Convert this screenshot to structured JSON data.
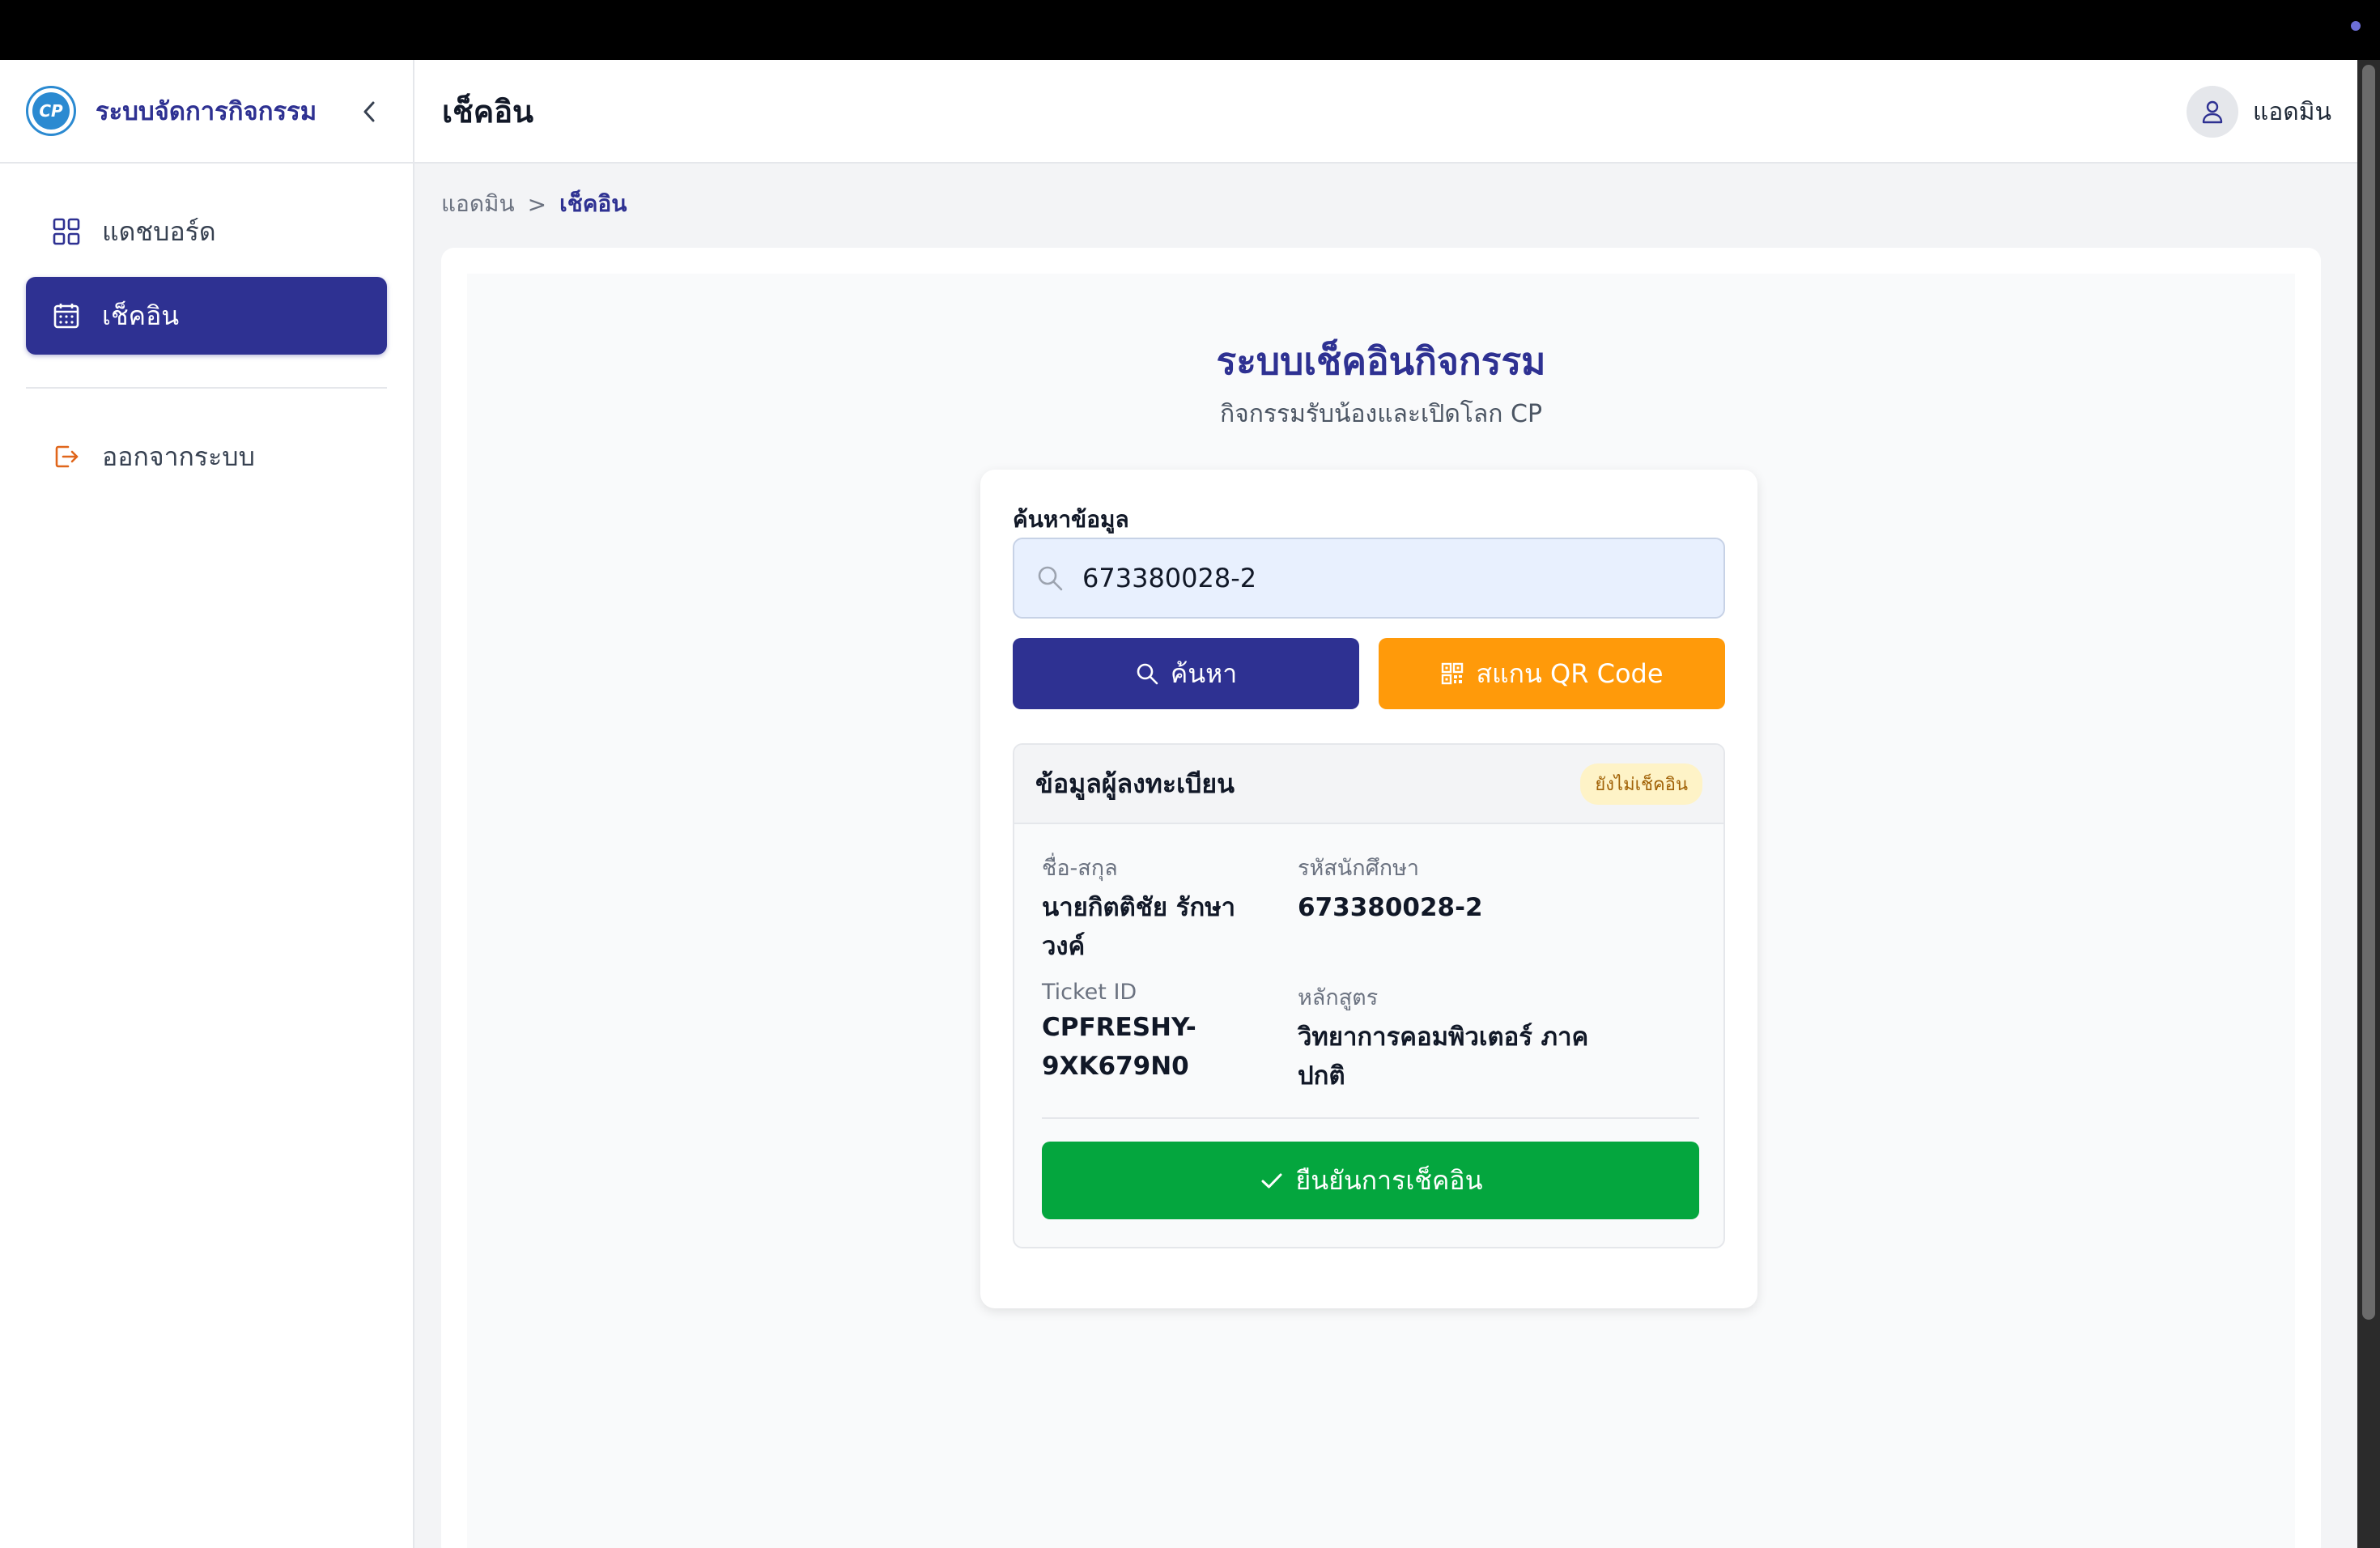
{
  "app": {
    "title": "ระบบจัดการกิจกรรม",
    "logo_text": "CP"
  },
  "sidebar": {
    "items": [
      {
        "label": "แดชบอร์ด",
        "icon": "grid-icon",
        "active": false
      },
      {
        "label": "เช็คอิน",
        "icon": "calendar-icon",
        "active": true
      }
    ],
    "logout_label": "ออกจากระบบ"
  },
  "header": {
    "title": "เช็คอิน",
    "user_name": "แอดมิน"
  },
  "breadcrumb": {
    "root": "แอดมิน",
    "separator": ">",
    "current": "เช็คอิน"
  },
  "main": {
    "title": "ระบบเช็คอินกิจกรรม",
    "subtitle": "กิจกรรมรับน้องและเปิดโลก CP"
  },
  "search": {
    "label": "ค้นหาข้อมูล",
    "value": "673380028-2",
    "search_button": "ค้นหา",
    "qr_button": "สแกน QR Code"
  },
  "registrant": {
    "section_title": "ข้อมูลผู้ลงทะเบียน",
    "status_badge": "ยังไม่เช็คอิน",
    "name_label": "ชื่อ-สกุล",
    "name_value": "นายกิตติชัย รักษาวงค์",
    "student_id_label": "รหัสนักศึกษา",
    "student_id_value": "673380028-2",
    "ticket_label": "Ticket ID",
    "ticket_value": "CPFRESHY-9XK679N0",
    "course_label": "หลักสูตร",
    "course_value": "วิทยาการคอมพิวเตอร์ ภาคปกติ",
    "confirm_button": "ยืนยันการเช็คอิน"
  },
  "colors": {
    "primary": "#2e3192",
    "accent": "#ff9a0a",
    "success": "#04a63e",
    "badge_bg": "#fef3c7",
    "badge_text": "#a16207"
  }
}
